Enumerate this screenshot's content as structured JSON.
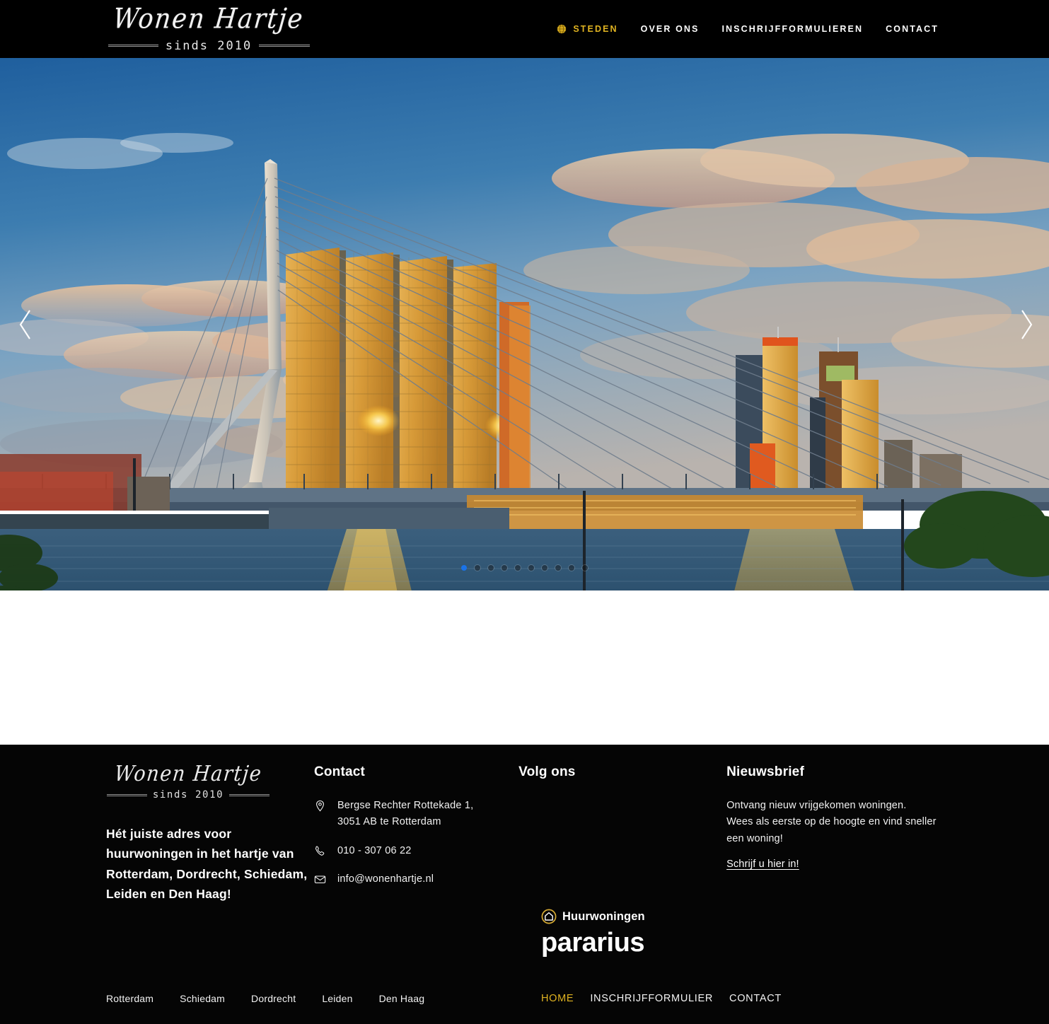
{
  "header": {
    "logo": {
      "script": "Wonen Hartje",
      "tagline": "sinds 2010"
    },
    "nav": [
      {
        "label": "STEDEN",
        "icon": "globe-icon",
        "active": true
      },
      {
        "label": "OVER ONS",
        "active": false
      },
      {
        "label": "INSCHRIJFFORMULIEREN",
        "active": false
      },
      {
        "label": "CONTACT",
        "active": false
      }
    ]
  },
  "hero": {
    "alt": "Erasmusbrug Rotterdam skyline bij zonsondergang",
    "prev_label": "‹",
    "next_label": "›",
    "slide_count": 10,
    "active_slide": 1,
    "colors": {
      "sky_top": "#2a6ba8",
      "sky_mid": "#6d9bc0",
      "cloud_warm": "#e8a97a",
      "tower_gold": "#d79a38",
      "water_dark": "#2d4a63",
      "sun_reflection": "#f0b63c",
      "grass": "#3f7a1e",
      "active_dot": "#1a73e8"
    }
  },
  "footer": {
    "logo": {
      "script": "Wonen Hartje",
      "tagline": "sinds 2010"
    },
    "tagline": "Hét juiste adres voor huurwoningen in het hartje van Rotterdam, Dordrecht, Schiedam, Leiden en Den Haag!",
    "contact": {
      "heading": "Contact",
      "address_line1": "Bergse Rechter Rottekade 1,",
      "address_line2": "3051 AB te Rotterdam",
      "phone": "010 - 307 06 22",
      "email": "info@wonenhartje.nl",
      "icons": {
        "address": "location-pin-icon",
        "phone": "phone-icon",
        "email": "envelope-icon"
      }
    },
    "follow": {
      "heading": "Volg ons"
    },
    "newsletter": {
      "heading": "Nieuwsbrief",
      "body_line1": "Ontvang nieuw vrijgekomen woningen.",
      "body_line2": "Wees als eerste op de hoogte en vind sneller",
      "body_line3": "een woning!",
      "link": "Schrijf u hier in!"
    },
    "partner": {
      "badge_label": "Huurwoningen",
      "badge_icon": "house-circle-icon",
      "brand": "pararius",
      "badge_color": "#d4a933"
    },
    "city_links": [
      "Rotterdam",
      "Schiedam",
      "Dordrecht",
      "Leiden",
      "Den Haag"
    ],
    "bottom_nav": [
      {
        "label": "HOME",
        "active": true
      },
      {
        "label": "INSCHRIJFFORMULIER",
        "active": false
      },
      {
        "label": "CONTACT",
        "active": false
      }
    ]
  }
}
